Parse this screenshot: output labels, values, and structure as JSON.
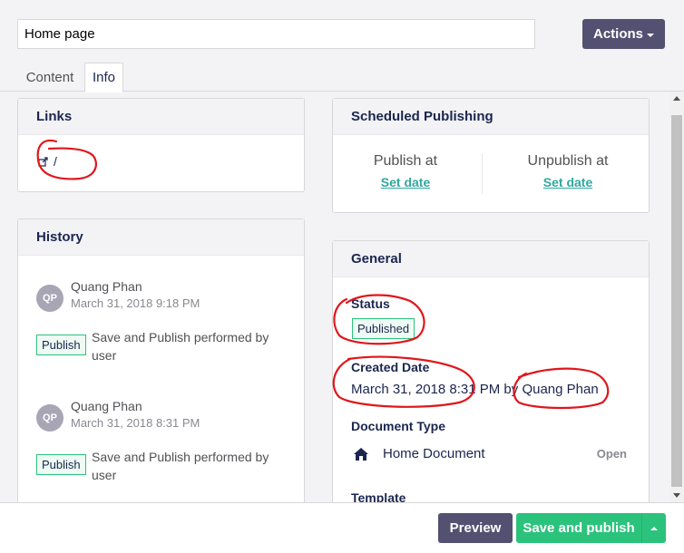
{
  "header": {
    "name_value": "Home page",
    "actions_label": "Actions"
  },
  "tabs": [
    {
      "label": "Content",
      "active": false
    },
    {
      "label": "Info",
      "active": true
    }
  ],
  "links": {
    "title": "Links",
    "items": [
      {
        "label": "/",
        "icon": "external-link-icon"
      }
    ]
  },
  "history": {
    "title": "History",
    "entries": [
      {
        "initials": "QP",
        "user": "Quang Phan",
        "date": "March 31, 2018 9:18 PM",
        "badge": "Publish",
        "description": "Save and Publish performed by user"
      },
      {
        "initials": "QP",
        "user": "Quang Phan",
        "date": "March 31, 2018 8:31 PM",
        "badge": "Publish",
        "description": "Save and Publish performed by user"
      }
    ]
  },
  "scheduled": {
    "title": "Scheduled Publishing",
    "publish_at_label": "Publish at",
    "unpublish_at_label": "Unpublish at",
    "set_date_label": "Set date"
  },
  "general": {
    "title": "General",
    "status_label": "Status",
    "status_value": "Published",
    "created_label": "Created Date",
    "created_value": "March 31, 2018 8:31 PM by Quang Phan",
    "doctype_label": "Document Type",
    "doctype_value": "Home Document",
    "doctype_icon": "home-icon",
    "open_label": "Open",
    "template_label": "Template"
  },
  "footer": {
    "preview_label": "Preview",
    "save_publish_label": "Save and publish"
  },
  "colors": {
    "accent_dark": "#545071",
    "accent_green": "#2bc37c",
    "link_teal": "#2ea8a0",
    "annotation_red": "#e0161c"
  }
}
